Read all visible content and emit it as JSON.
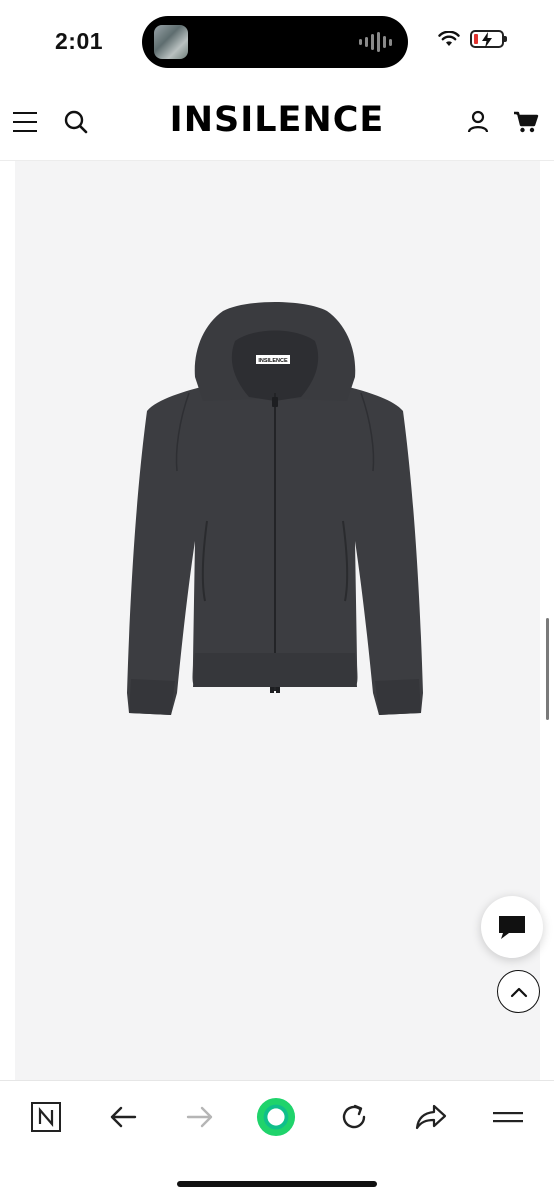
{
  "status_bar": {
    "time": "2:01"
  },
  "header": {
    "brand": "INSILENCE",
    "icons": {
      "menu": "hamburger-icon",
      "search": "search-icon",
      "account": "user-icon",
      "cart": "cart-icon"
    }
  },
  "product": {
    "label_tag": "INSILENCE",
    "image_background": "#f4f4f5",
    "garment_color": "#3c3d41"
  },
  "floating": {
    "chat_icon": "chat-icon",
    "scroll_top_icon": "chevron-up-icon"
  },
  "browser_toolbar": {
    "items": [
      "naver-icon",
      "back-arrow-icon",
      "forward-arrow-icon",
      "green-dot-icon",
      "refresh-icon",
      "share-icon",
      "menu-icon"
    ],
    "accent": "#1fd36b"
  }
}
